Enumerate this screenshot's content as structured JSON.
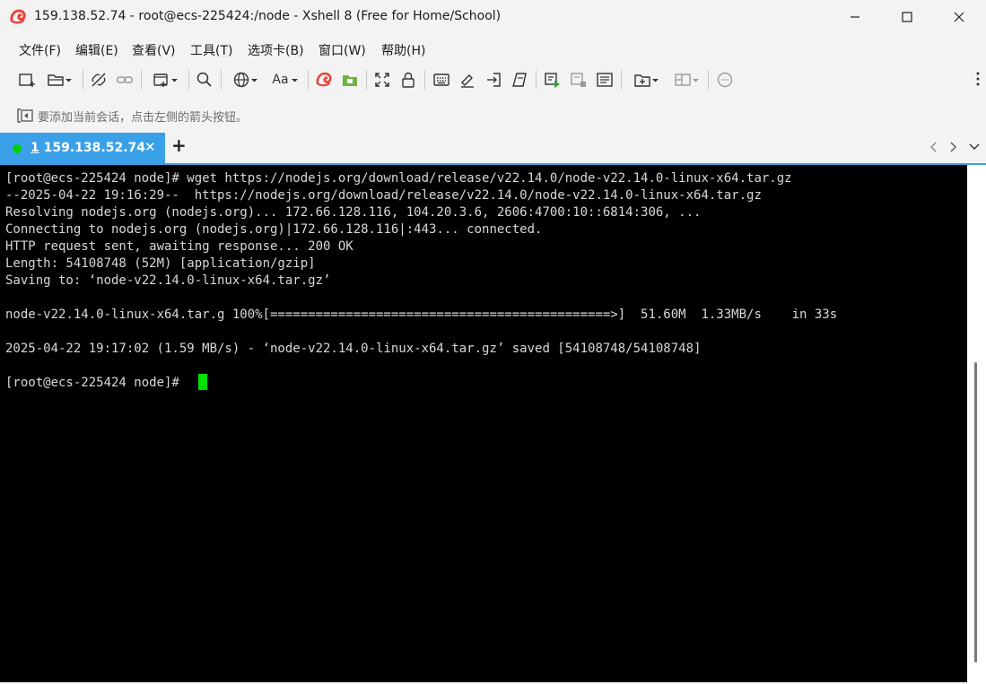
{
  "window": {
    "title": "159.138.52.74 - root@ecs-225424:/node - Xshell 8 (Free for Home/School)",
    "icon": "xshell-logo"
  },
  "menu": [
    {
      "label": "文件(F)"
    },
    {
      "label": "编辑(E)"
    },
    {
      "label": "查看(V)"
    },
    {
      "label": "工具(T)"
    },
    {
      "label": "选项卡(B)"
    },
    {
      "label": "窗口(W)"
    },
    {
      "label": "帮助(H)"
    }
  ],
  "toolbar": {
    "font_label": "Aa",
    "icons": [
      "new-session-icon",
      "open-folder-icon",
      "disconnect-icon",
      "reconnect-icon",
      "new-window-icon",
      "search-icon",
      "globe-icon",
      "font-icon",
      "xshell-icon",
      "xftp-icon",
      "fullscreen-icon",
      "lock-icon",
      "keyboard-icon",
      "highlight-icon",
      "transfer-icon",
      "script-icon",
      "run-script-icon",
      "stop-script-icon",
      "log-icon",
      "add-tab-icon",
      "layout-icon",
      "chat-icon",
      "more-icon"
    ]
  },
  "hint": {
    "text": "要添加当前会话，点击左侧的箭头按钮。"
  },
  "tabs": [
    {
      "number": "1",
      "label": " 159.138.52.74",
      "status_color": "#00d000",
      "active": true
    }
  ],
  "terminal": {
    "lines": [
      "[root@ecs-225424 node]# wget https://nodejs.org/download/release/v22.14.0/node-v22.14.0-linux-x64.tar.gz",
      "--2025-04-22 19:16:29--  https://nodejs.org/download/release/v22.14.0/node-v22.14.0-linux-x64.tar.gz",
      "Resolving nodejs.org (nodejs.org)... 172.66.128.116, 104.20.3.6, 2606:4700:10::6814:306, ...",
      "Connecting to nodejs.org (nodejs.org)|172.66.128.116|:443... connected.",
      "HTTP request sent, awaiting response... 200 OK",
      "Length: 54108748 (52M) [application/gzip]",
      "Saving to: ‘node-v22.14.0-linux-x64.tar.gz’",
      "",
      "node-v22.14.0-linux-x64.tar.g 100%[=============================================>]  51.60M  1.33MB/s    in 33s",
      "",
      "2025-04-22 19:17:02 (1.59 MB/s) - ‘node-v22.14.0-linux-x64.tar.gz’ saved [54108748/54108748]",
      "",
      "[root@ecs-225424 node]# "
    ],
    "cursor_color": "#00e000",
    "background": "#000000",
    "foreground": "#d8d8d8"
  },
  "colors": {
    "accent": "#3aa0e8",
    "chrome": "#f3f3f3"
  }
}
